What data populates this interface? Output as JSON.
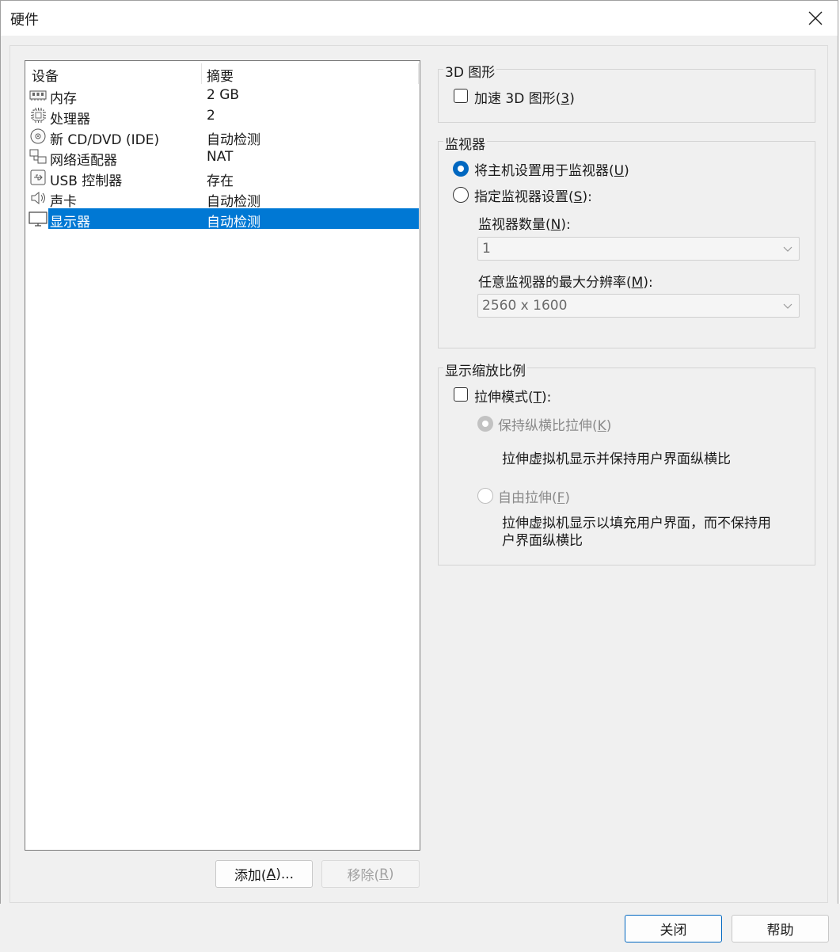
{
  "window": {
    "title": "硬件"
  },
  "device_list": {
    "headers": [
      "设备",
      "摘要"
    ],
    "rows": [
      {
        "icon": "memory-icon",
        "name": "内存",
        "summary": "2 GB"
      },
      {
        "icon": "cpu-icon",
        "name": "处理器",
        "summary": "2"
      },
      {
        "icon": "disc-icon",
        "name": "新 CD/DVD (IDE)",
        "summary": "自动检测"
      },
      {
        "icon": "network-icon",
        "name": "网络适配器",
        "summary": "NAT"
      },
      {
        "icon": "usb-icon",
        "name": "USB 控制器",
        "summary": "存在"
      },
      {
        "icon": "speaker-icon",
        "name": "声卡",
        "summary": "自动检测"
      },
      {
        "icon": "monitor-icon",
        "name": "显示器",
        "summary": "自动检测",
        "selected": true
      }
    ]
  },
  "list_buttons": {
    "add": {
      "label": "添加(",
      "key": "A",
      "suffix": ")..."
    },
    "remove": {
      "label": "移除(",
      "key": "R",
      "suffix": ")"
    }
  },
  "graphics_3d": {
    "title": "3D 图形",
    "accelerate": {
      "label": "加速 3D 图形(",
      "key": "3",
      "suffix": ")",
      "checked": false
    }
  },
  "monitor": {
    "title": "监视器",
    "use_host": {
      "label": "将主机设置用于监视器(",
      "key": "U",
      "suffix": ")",
      "selected": true
    },
    "specify": {
      "label": "指定监视器设置(",
      "key": "S",
      "suffix": "):",
      "selected": false
    },
    "count": {
      "label": "监视器数量(",
      "key": "N",
      "suffix": "):",
      "value": "1"
    },
    "max_res": {
      "label": "任意监视器的最大分辨率(",
      "key": "M",
      "suffix": "):",
      "value": "2560 x 1600"
    }
  },
  "scaling": {
    "title": "显示缩放比例",
    "stretch": {
      "label": "拉伸模式(",
      "key": "T",
      "suffix": "):",
      "checked": false
    },
    "keep_aspect": {
      "label": "保持纵横比拉伸(",
      "key": "K",
      "suffix": ")",
      "selected": true
    },
    "keep_aspect_desc": "拉伸虚拟机显示并保持用户界面纵横比",
    "free": {
      "label": "自由拉伸(",
      "key": "F",
      "suffix": ")",
      "selected": false
    },
    "free_desc_1": "拉伸虚拟机显示以填充用户界面，而不保持用",
    "free_desc_2": "户界面纵横比"
  },
  "footer": {
    "close": "关闭",
    "help": "帮助"
  },
  "colors": {
    "selection": "#0078d4",
    "accent": "#0067c0"
  }
}
